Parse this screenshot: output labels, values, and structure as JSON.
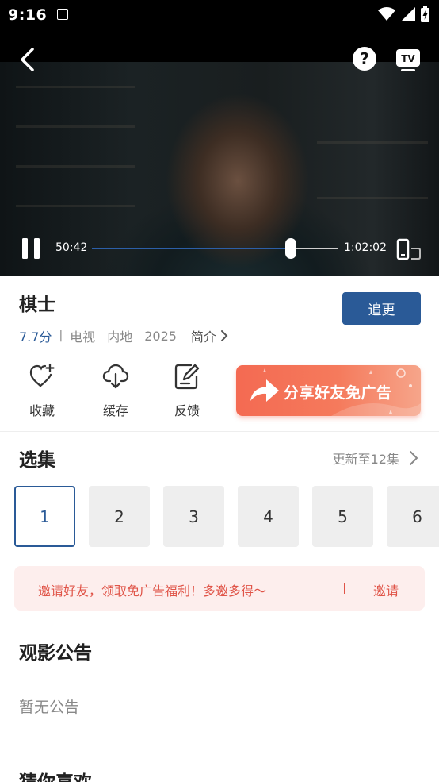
{
  "status_bar": {
    "time": "9:16",
    "icons": [
      "app-notification-icon",
      "wifi-icon",
      "signal-icon",
      "battery-charging-icon"
    ]
  },
  "player": {
    "current_time": "50:42",
    "total_time": "1:02:02",
    "progress": 0.811,
    "icons": {
      "back": "back-arrow-icon",
      "help": "question-circle-icon",
      "cast": "tv-cast-icon",
      "pause": "pause-icon",
      "rotate": "rotate-screen-icon"
    },
    "accent_color": "#2c5fa8"
  },
  "info": {
    "title": "棋士",
    "follow_label": "追更",
    "score": "7.7分",
    "separator": "|",
    "tags": [
      "电视",
      "内地",
      "2025"
    ],
    "intro_label": "简介"
  },
  "actions": [
    {
      "label": "收藏",
      "icon": "heart-plus-icon"
    },
    {
      "label": "缓存",
      "icon": "cloud-download-icon"
    },
    {
      "label": "反馈",
      "icon": "edit-note-icon"
    }
  ],
  "share_banner": {
    "label": "分享好友免广告",
    "icon": "share-arrow-icon"
  },
  "episodes": {
    "section_title": "选集",
    "update_label": "更新至12集",
    "items": [
      "1",
      "2",
      "3",
      "4",
      "5",
      "6"
    ],
    "selected": "1"
  },
  "invite": {
    "text": "邀请好友，领取免广告福利！多邀多得～",
    "link": "邀请"
  },
  "notice": {
    "section_title": "观影公告",
    "empty_text": "暂无公告"
  },
  "recommend": {
    "section_title": "猜你喜欢"
  },
  "colors": {
    "brand": "#2a5a97",
    "invite_text": "#e05448",
    "invite_bg": "#fdeeed",
    "share_gradient_start": "#f46a52"
  }
}
